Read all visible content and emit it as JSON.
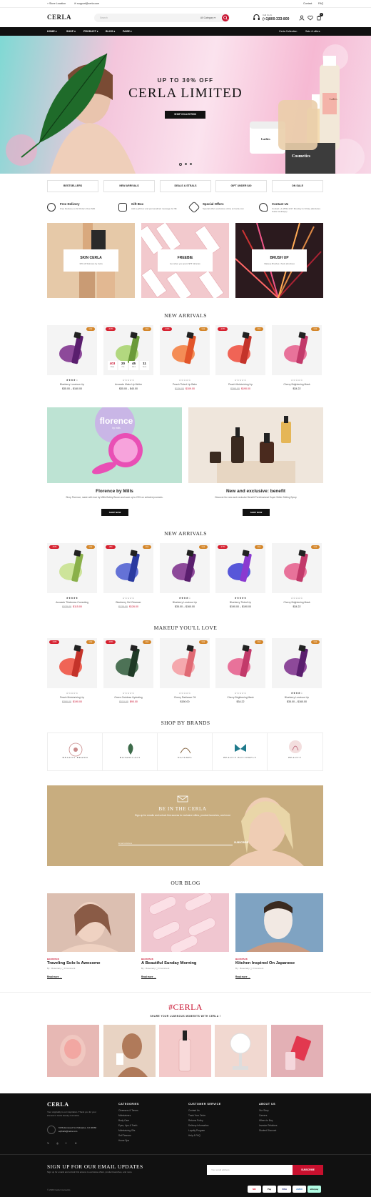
{
  "topbar": {
    "location": "Store Location",
    "email": "support@cerla.com",
    "contact": "Contact",
    "faq": "FAQ"
  },
  "header": {
    "logo": "CERLA",
    "search_placeholder": "Search",
    "category_select": "All Category",
    "phone_label": "Call Us At",
    "phone": "(+1)800-333-800",
    "cart_count": "0"
  },
  "nav": {
    "items": [
      "HOME",
      "SHOP",
      "PRODUCT",
      "BLOG",
      "PAGE"
    ],
    "right_items": [
      "Cerla Collection",
      "Sale & offers"
    ]
  },
  "hero": {
    "eyebrow": "UP TO 30% OFF",
    "title": "CERLA LIMITED",
    "button": "SHOP COLLECTION",
    "bottle_label": "Ladies",
    "jar_label": "Ladies",
    "box_label": "Cosmetics"
  },
  "quick_categories": [
    "BESTSELLERS",
    "NEW ARRIVALS",
    "DEALS & STEALS",
    "GIFT UNDER $40",
    "ON SALE"
  ],
  "features": [
    {
      "title": "Free Delivery",
      "desc": "Free Delivery on All Orders Over $30",
      "icon": "delivery-icon"
    },
    {
      "title": "Gift Box",
      "desc": "Add a gift box and personalized message for $5",
      "icon": "gift-icon"
    },
    {
      "title": "Special Offers",
      "desc": "Special offers exclusive online at Cerla.com",
      "icon": "offer-icon"
    },
    {
      "title": "Contact Us",
      "desc": "Contact +1 (859) 4217 Monday to Friday (Excludes Public Holidays)",
      "icon": "contact-icon"
    }
  ],
  "promos": [
    {
      "title": "SKIN CERLA",
      "desc": "30% off Skincare by Cerla"
    },
    {
      "title": "FREEBIE",
      "desc": "Get when you spend $75 Skincare"
    },
    {
      "title": "BRUSH UP",
      "desc": "Makeup Brushes | Tools (brushes)"
    }
  ],
  "section_titles": {
    "new_arrivals_1": "NEW ARRIVALS",
    "new_arrivals_2": "NEW ARRIVALS",
    "makeup": "MAKEUP YOU'LL LOVE",
    "brands": "SHOP BY BRANDS",
    "blog": "OUR BLOG",
    "hashtag": "#CERLA",
    "hashtag_sub": "SHARE YOUR LUMINOUS MOMENTS WITH CERLA !"
  },
  "products_1": [
    {
      "name": "Blueberry Luscious Lip",
      "old": "",
      "price": "$35.00 – $160.00",
      "badges": [
        "Hot"
      ],
      "stars": "★★★★☆"
    },
    {
      "name": "Avocado Make Up Melter",
      "old": "",
      "price": "$35.00 – $40.00",
      "badges": [
        "-22%",
        "Hot"
      ],
      "stars": "☆☆☆☆☆",
      "timer": [
        "403",
        "20",
        "45",
        "11"
      ],
      "timer_labels": [
        "Days",
        "Hrs",
        "Mins",
        "Secs"
      ]
    },
    {
      "name": "Peach Tinted Lip Balm",
      "old": "$136.00",
      "price": "$109.00",
      "badges": [
        "-13%",
        "Hot"
      ],
      "stars": "☆☆☆☆☆"
    },
    {
      "name": "Peach Moisturizing Lip",
      "old": "$390.00",
      "price": "$190.00",
      "badges": [
        "-13%",
        "Hot"
      ],
      "stars": "☆☆☆☆☆"
    },
    {
      "name": "Cherry Brightening Mask",
      "old": "",
      "price": "$34.22",
      "badges": [
        "Hot"
      ],
      "stars": "☆☆☆☆☆"
    }
  ],
  "feature_banners": [
    {
      "title": "Florence by Mills",
      "desc": "Shop Florence, made with love by Millie Bobby Brown and save up to 20% on selected products.",
      "button": "SHOP NOW",
      "brand": "florence",
      "brand_sub": "by mills"
    },
    {
      "title": "New and exclusive: benefit",
      "desc": "Discover the new and exclusive Benefit Porefessional Super Setter Setting Spray",
      "button": "SHOP NOW"
    }
  ],
  "products_2": [
    {
      "name": "Avocado Thickness Correcting",
      "old": "$135.00",
      "price": "$115.00",
      "badges": [
        "-15%",
        "Hot"
      ],
      "stars": "★★★★★"
    },
    {
      "name": "Blueberry Gel Cleanser",
      "old": "$135.00",
      "price": "$126.00",
      "badges": [
        "-8%",
        "Hot"
      ],
      "stars": "☆☆☆☆☆"
    },
    {
      "name": "Blueberry Luscious Lip",
      "old": "",
      "price": "$35.00 – $160.00",
      "badges": [
        "Hot"
      ],
      "stars": "★★★★☆"
    },
    {
      "name": "Blueberry Tinted Lip",
      "old": "",
      "price": "$190.00 – $190.00",
      "badges": [
        "-17%",
        "Hot"
      ],
      "stars": "★★★★★"
    },
    {
      "name": "Cherry Brightening Mask",
      "old": "",
      "price": "$34.22",
      "badges": [
        "Hot"
      ],
      "stars": "☆☆☆☆☆"
    }
  ],
  "products_3": [
    {
      "name": "Peach Moisturizing Lip",
      "old": "$390.00",
      "price": "$190.00",
      "badges": [
        "-13%",
        "Hot"
      ],
      "stars": "☆☆☆☆☆"
    },
    {
      "name": "Green Goddess Hydrating",
      "old": "$110.00",
      "price": "$90.00",
      "badges": [
        "-19%",
        "Hot"
      ],
      "stars": "☆☆☆☆☆"
    },
    {
      "name": "Cherry Radiance Oil",
      "old": "",
      "price": "$150.00",
      "badges": [
        "Hot"
      ],
      "stars": "☆☆☆☆☆"
    },
    {
      "name": "Cherry Brightening Mask",
      "old": "",
      "price": "$34.22",
      "badges": [
        "Hot"
      ],
      "stars": "☆☆☆☆☆"
    },
    {
      "name": "Blueberry Luscious Lip",
      "old": "",
      "price": "$35.00 – $160.00",
      "badges": [
        "Hot"
      ],
      "stars": "★★★★☆"
    }
  ],
  "brands": [
    "BEAUTY BRAND",
    "BOTANICALS",
    "NATUREL",
    "BEAUTY BUTTERFLY",
    "BEAUTY"
  ],
  "newsletter_banner": {
    "title": "BE IN THE CERLA",
    "desc": "Sign up for emails and unlock first access to exclusive offers, product launches, and more",
    "placeholder": "Email Address",
    "button": "SUBSCRIBE"
  },
  "blog": [
    {
      "tag": "BACKPACK",
      "title": "Traveling Solo Is Awesome",
      "author": "By : Rosemary",
      "comments": "0 Comment",
      "more": "Read more"
    },
    {
      "tag": "BACKPACK",
      "title": "A Beautiful Sunday Morning",
      "author": "By : Rosemary",
      "comments": "0 Comment",
      "more": "Read more"
    },
    {
      "tag": "BACKPACK",
      "title": "Kitchen Inspired On Japanese",
      "author": "By : Rosemary",
      "comments": "0 Comment",
      "more": "Read more"
    }
  ],
  "footer": {
    "logo": "CERLA",
    "about": "Your originality is our inspiration. Thank you for your interest in Cerla beauty cosmetics",
    "address": "63 Buttonwood St, Palisades, CA 40060",
    "email": "eqthells@cerla.com",
    "col_headers": [
      "CATEGORIES",
      "CUSTOMER SERVICE",
      "ABOUT US"
    ],
    "categories": [
      "Cleansers & Toners",
      "Moisturizers",
      "Body Care",
      "Eyes, Lips & Teeth",
      "Moisturizing Oils",
      "Self Tanners",
      "Home Spa"
    ],
    "service": [
      "Contact Us",
      "Track Your Order",
      "Returns Policy",
      "Delivery Information",
      "Loyalty Program",
      "Help & FAQ"
    ],
    "about_links": [
      "Our Story",
      "Careers",
      "Where to Buy",
      "Investor Relations",
      "Student Discount"
    ],
    "signup_title": "SIGN UP FOR OUR EMAIL UPDATES",
    "signup_desc": "Sign up for emails and unlock first access to exclusive offers, product launches, and more",
    "signup_placeholder": "Your email address",
    "signup_button": "SUBSCRIBE",
    "copyright": "© 2023 Cerla Cosmetics",
    "payments": [
      "MC",
      "Pay",
      "VISA",
      "AMEX",
      "afterpay"
    ]
  }
}
